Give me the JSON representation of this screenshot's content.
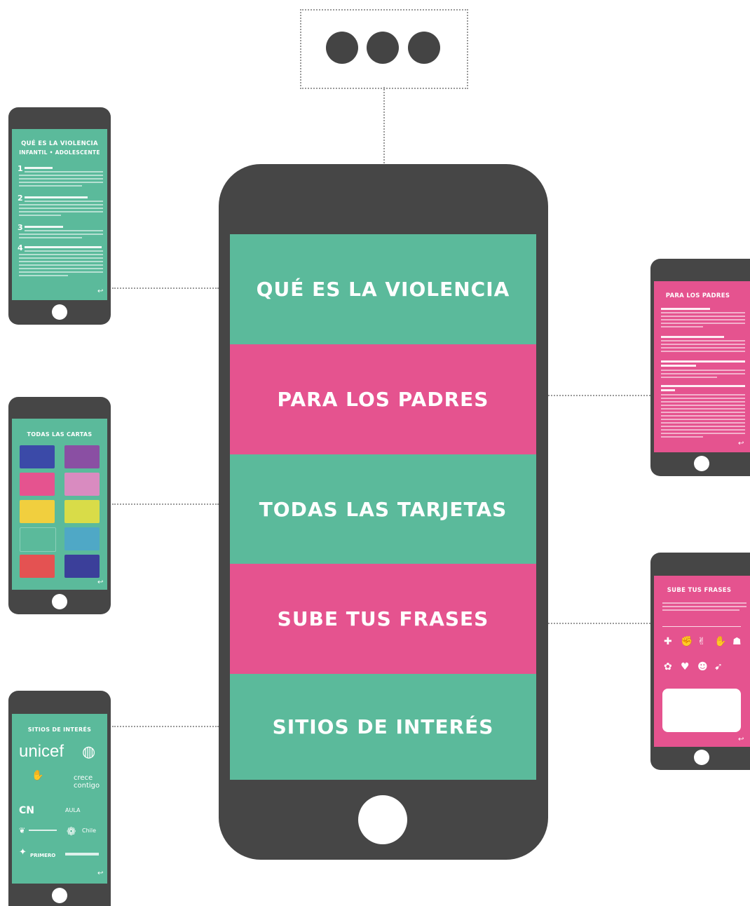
{
  "colors": {
    "teal": "#5bba9b",
    "pink": "#e5538f",
    "phone": "#464646",
    "connector": "#9a9a9a"
  },
  "main_menu": {
    "items": [
      {
        "label": "QUÉ ES LA VIOLENCIA",
        "color": "teal"
      },
      {
        "label": "PARA LOS PADRES",
        "color": "pink"
      },
      {
        "label": "TODAS LAS TARJETAS",
        "color": "teal"
      },
      {
        "label": "SUBE TUS FRASES",
        "color": "pink"
      },
      {
        "label": "SITIOS DE INTERÉS",
        "color": "teal"
      }
    ]
  },
  "more_icon": "three-dots-icon",
  "screens": {
    "violencia": {
      "title_line1": "QUÉ ES LA VIOLENCIA",
      "title_line2": "INFANTIL • ADOLESCENTE",
      "sections": [
        "1",
        "2",
        "3",
        "4"
      ]
    },
    "padres": {
      "title": "PARA LOS PADRES"
    },
    "cartas": {
      "title": "TODAS LAS CARTAS"
    },
    "frases": {
      "title": "SUBE TUS FRASES"
    },
    "sitios": {
      "title": "SITIOS DE INTERÉS",
      "logos": {
        "unicef": "unicef",
        "crece1": "crece",
        "crece2": "contigo",
        "aula": "AULA",
        "chile": "Chile",
        "primero": "PRIMERO"
      }
    }
  }
}
